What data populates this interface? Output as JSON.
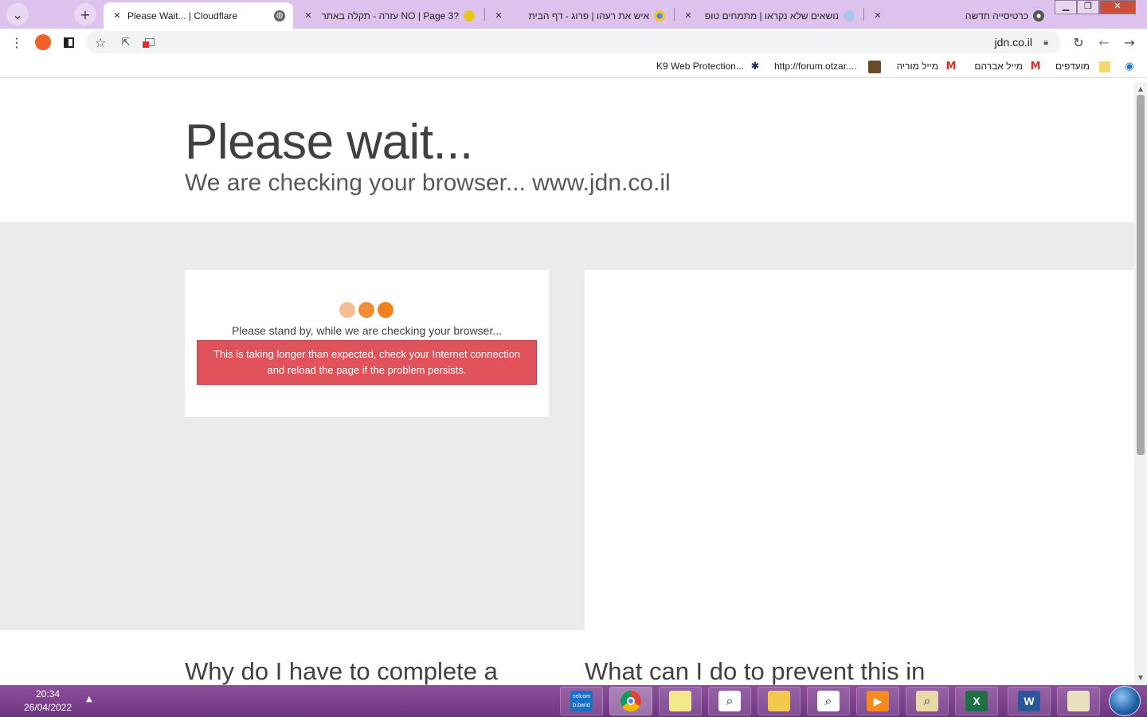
{
  "browser": {
    "tabs": [
      {
        "title": "Please Wait... | Cloudflare",
        "active": true,
        "favicon": "globe-icon"
      },
      {
        "title": "?NO | Page 3 עזרה - תקלה באתר",
        "active": false,
        "favicon": "yellow-cloud-icon"
      },
      {
        "title": "איש את רעהו | פרוג - דף הבית",
        "active": false,
        "favicon": "orange-yellow-circle-icon"
      },
      {
        "title": "נושאים שלא נקראו | מתמחים טופ",
        "active": false,
        "favicon": "blue-flower-icon"
      },
      {
        "title": "כרטיסייה חדשה",
        "active": false,
        "favicon": "chrome-icon"
      }
    ],
    "new_tab_symbol": "+",
    "tab_search_symbol": "⌄",
    "address_bar": {
      "url": "jdn.co.il"
    },
    "bookmarks": [
      {
        "label": "מועדפים",
        "icon": "folder-icon"
      },
      {
        "label": "מייל אברהם",
        "icon": "gmail-icon"
      },
      {
        "label": "מייל מוריה",
        "icon": "gmail-icon"
      },
      {
        "label": "http://forum.otzar....",
        "icon": "book-icon"
      },
      {
        "label": "K9 Web Protection...",
        "icon": "k9-icon"
      }
    ]
  },
  "page": {
    "title": "Please wait...",
    "subtitle": "We are checking your browser... www.jdn.co.il",
    "standby_text": "Please stand by, while we are checking your browser...",
    "alert_line1": "This is taking longer than expected, check your Internet connection",
    "alert_line2": "and reload the page if the problem persists.",
    "faq_left": "Why do I have to complete a",
    "faq_right": "What can I do to prevent this in"
  },
  "colors": {
    "tabstrip": "#ddc2ee",
    "alert_bg": "#e0535a",
    "grey_band": "#ebebeb",
    "dot1": "#f6bd95",
    "dot2": "#f28c36",
    "dot3": "#f08020"
  },
  "taskbar": {
    "time": "20:34",
    "date": "26/04/2022",
    "apps": [
      {
        "name": "celcom-bband-app",
        "label": "celcom b.band"
      },
      {
        "name": "chrome-app",
        "label": ""
      },
      {
        "name": "sticky-notes-app",
        "label": ""
      },
      {
        "name": "search-tool-app",
        "label": ""
      },
      {
        "name": "file-explorer-app",
        "label": ""
      },
      {
        "name": "book-search-app",
        "label": ""
      },
      {
        "name": "media-player-app",
        "label": ""
      },
      {
        "name": "search-users-app",
        "label": ""
      },
      {
        "name": "excel-app",
        "label": ""
      },
      {
        "name": "word-app",
        "label": ""
      },
      {
        "name": "control-panel-app",
        "label": ""
      }
    ]
  }
}
